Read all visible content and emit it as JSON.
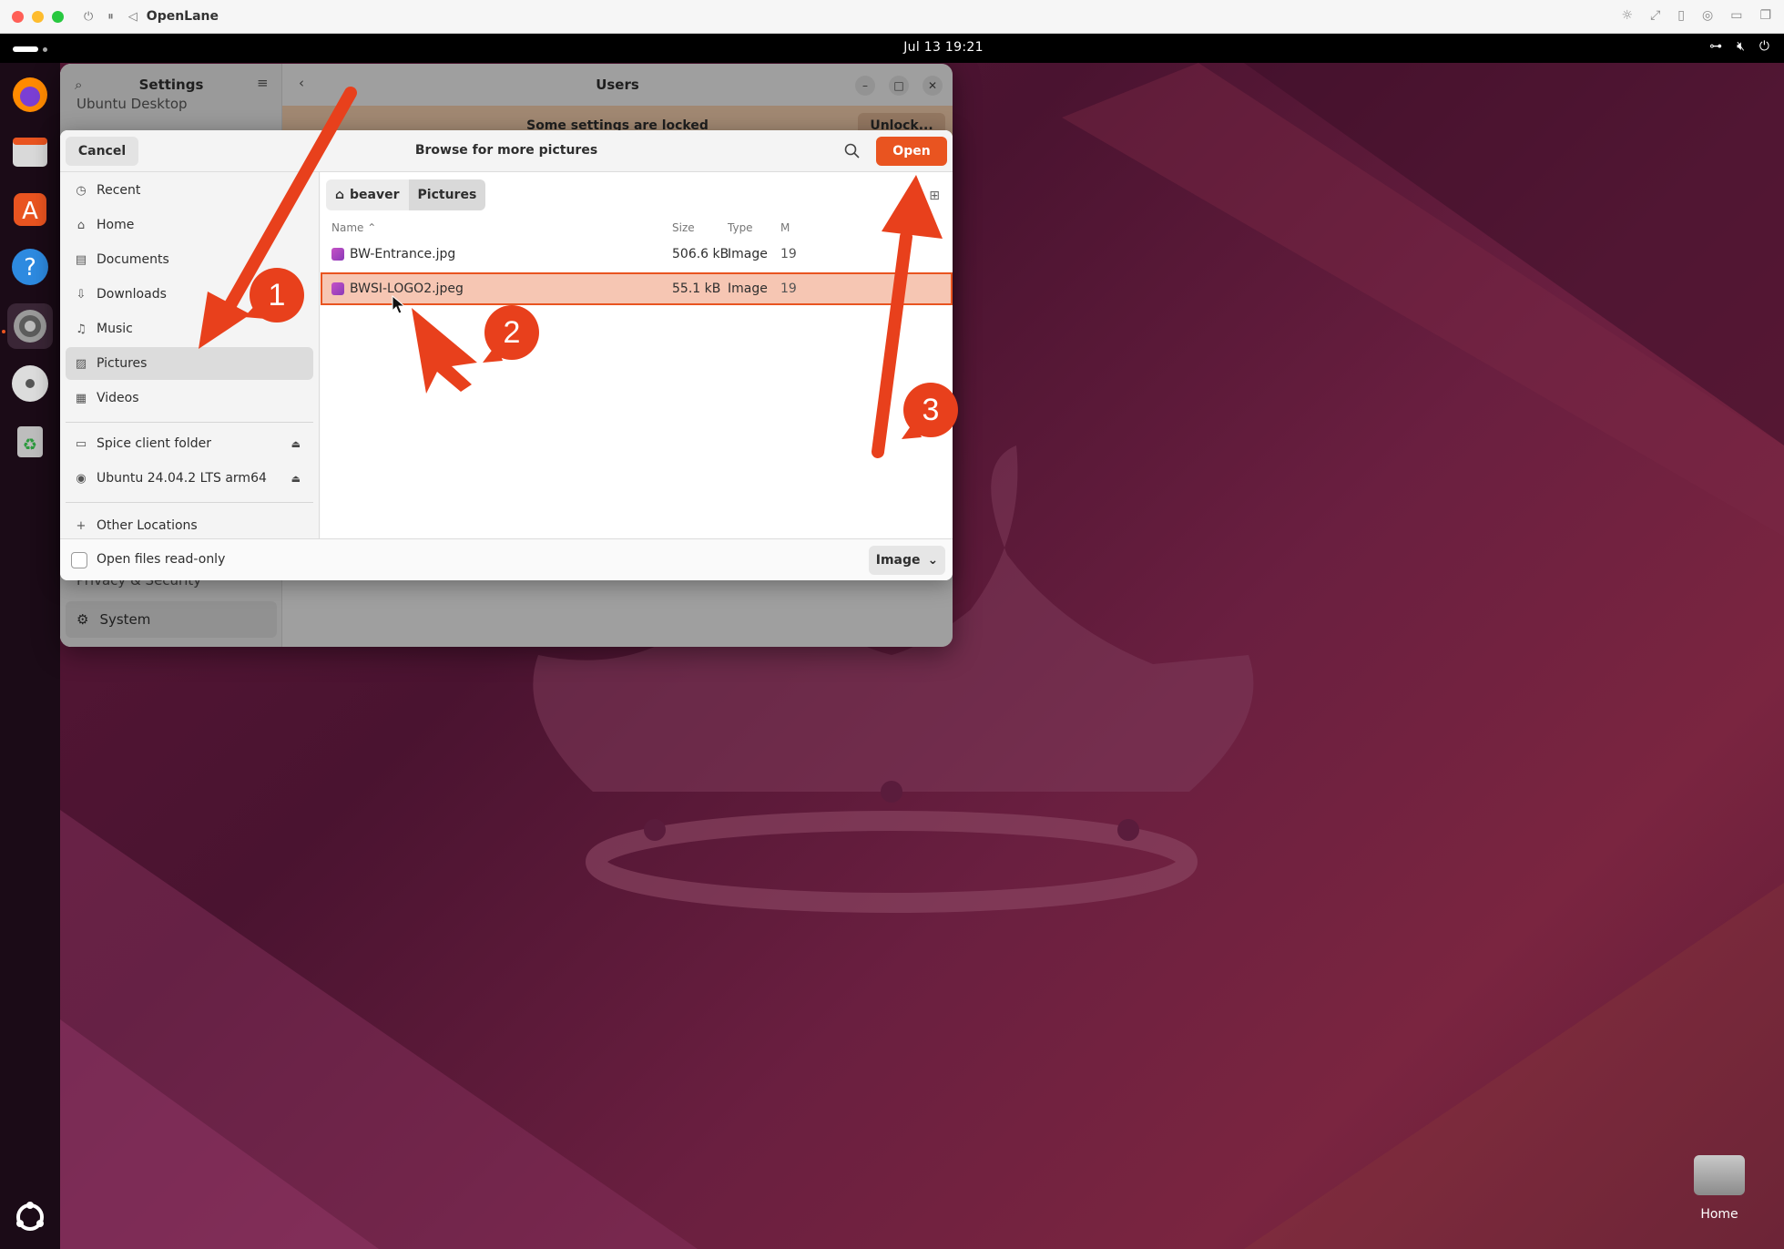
{
  "host": {
    "app_title": "OpenLane"
  },
  "topbar": {
    "clock": "Jul 13  19:21"
  },
  "settings_window": {
    "sidebar_title": "Settings",
    "page_title": "Users",
    "partial_item": "Ubuntu Desktop",
    "locked_text": "Some settings are locked",
    "unlock_label": "Unlock...",
    "privacy_item": "Privacy & Security",
    "system_item": "System"
  },
  "dialog": {
    "title": "Browse for more pictures",
    "cancel_label": "Cancel",
    "open_label": "Open",
    "places": [
      {
        "label": "Recent",
        "icon": "clock-icon"
      },
      {
        "label": "Home",
        "icon": "home-icon"
      },
      {
        "label": "Documents",
        "icon": "document-icon"
      },
      {
        "label": "Downloads",
        "icon": "download-icon"
      },
      {
        "label": "Music",
        "icon": "music-icon"
      },
      {
        "label": "Pictures",
        "icon": "picture-icon",
        "selected": true
      },
      {
        "label": "Videos",
        "icon": "video-icon"
      }
    ],
    "devices": [
      {
        "label": "Spice client folder",
        "icon": "folder-icon"
      },
      {
        "label": "Ubuntu 24.04.2 LTS arm64",
        "icon": "disc-icon"
      }
    ],
    "other_locations": "Other Locations",
    "path": [
      "beaver",
      "Pictures"
    ],
    "columns": {
      "name": "Name",
      "size": "Size",
      "type": "Type",
      "modified": "M"
    },
    "files": [
      {
        "name": "BW-Entrance.jpg",
        "size": "506.6 kB",
        "type": "Image",
        "modified": "19"
      },
      {
        "name": "BWSI-LOGO2.jpeg",
        "size": "55.1 kB",
        "type": "Image",
        "modified": "19",
        "selected": true
      }
    ],
    "read_only_label": "Open files read-only",
    "filter_label": "Image"
  },
  "annotations": {
    "step1": "1",
    "step2": "2",
    "step3": "3",
    "color": "#e8401c"
  },
  "desktop": {
    "home_label": "Home"
  }
}
